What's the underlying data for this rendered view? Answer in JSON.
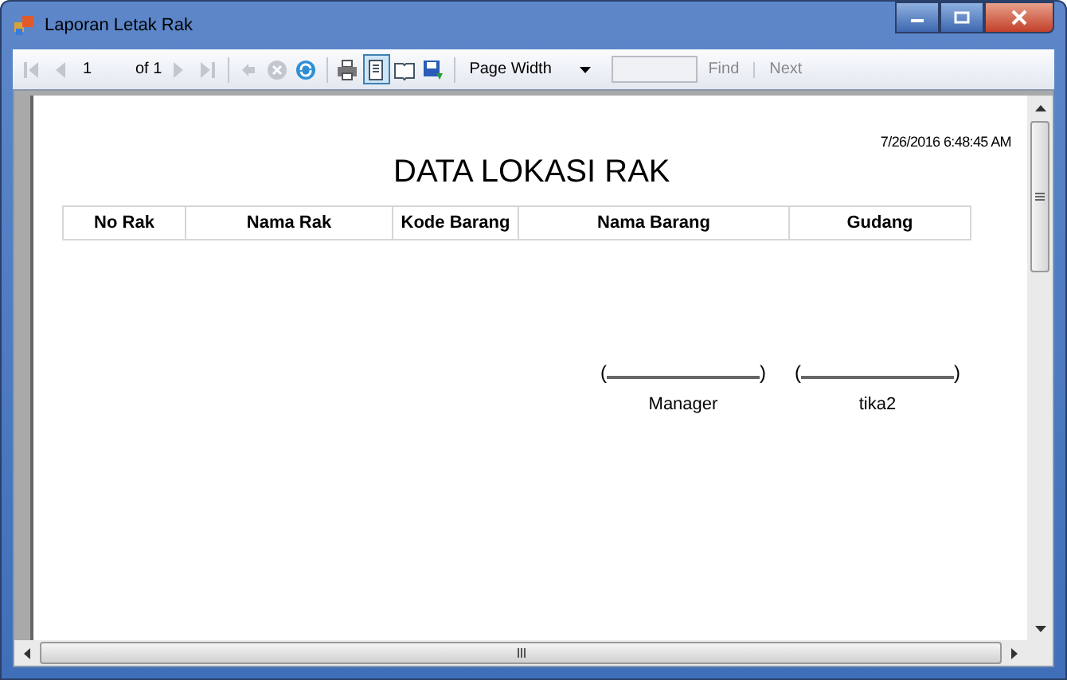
{
  "window": {
    "title": "Laporan Letak Rak"
  },
  "toolbar": {
    "page": "1",
    "of": "of 1",
    "zoom": "Page Width",
    "find": "Find",
    "next": "Next",
    "buttons": [
      {
        "kind": "first",
        "disabled": true
      },
      {
        "kind": "prev",
        "disabled": true
      },
      {
        "kind": "pagebox"
      },
      {
        "kind": "next",
        "disabled": true
      },
      {
        "kind": "last",
        "disabled": true
      },
      {
        "kind": "sep"
      },
      {
        "kind": "back",
        "disabled": true
      },
      {
        "kind": "stop",
        "disabled": true
      },
      {
        "kind": "refresh",
        "disabled": false
      },
      {
        "kind": "sep"
      },
      {
        "kind": "print",
        "disabled": false
      },
      {
        "kind": "layout",
        "disabled": false,
        "selected": true
      },
      {
        "kind": "setup",
        "disabled": false,
        "selected": false
      },
      {
        "kind": "export",
        "disabled": false
      }
    ]
  },
  "report": {
    "timestamp": "7/26/2016 6:48:45 AM",
    "title": "DATA LOKASI RAK",
    "columns": [
      "No Rak",
      "Nama Rak",
      "Kode Barang",
      "Nama Barang",
      "Gudang"
    ],
    "signatures": [
      {
        "open": "(",
        "close": ")",
        "name": "Manager"
      },
      {
        "open": "(",
        "close": ")",
        "name": "tika2"
      }
    ]
  }
}
